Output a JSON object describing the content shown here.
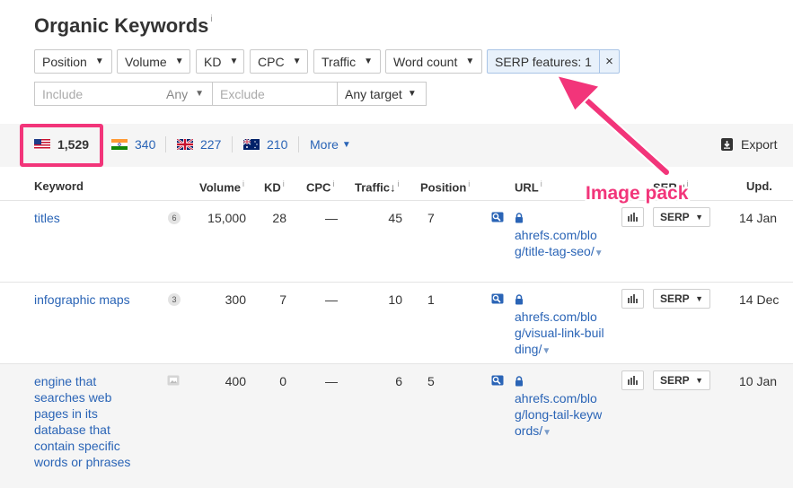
{
  "page": {
    "title": "Organic Keywords",
    "info_mark": "i"
  },
  "filters": {
    "position": "Position",
    "volume": "Volume",
    "kd": "KD",
    "cpc": "CPC",
    "traffic": "Traffic",
    "word_count": "Word count",
    "serp_features": "SERP features: 1",
    "serp_clear": "×",
    "caret": "▼"
  },
  "search": {
    "include_placeholder": "Include",
    "any_label": "Any",
    "exclude_placeholder": "Exclude",
    "any_target": "Any target"
  },
  "countries": [
    {
      "code": "us",
      "count": "1,529"
    },
    {
      "code": "in",
      "count": "340"
    },
    {
      "code": "gb",
      "count": "227"
    },
    {
      "code": "au",
      "count": "210"
    }
  ],
  "more_label": "More",
  "export_label": "Export",
  "table": {
    "headers": {
      "keyword": "Keyword",
      "volume": "Volume",
      "kd": "KD",
      "cpc": "CPC",
      "traffic": "Traffic",
      "traffic_sort": "↓",
      "position": "Position",
      "url": "URL",
      "serp": "SERP",
      "upd": "Upd."
    },
    "rows": [
      {
        "keyword": "titles",
        "badge": "6",
        "volume": "15,000",
        "kd": "28",
        "cpc": "—",
        "traffic": "45",
        "position": "7",
        "url": "ahrefs.com/blog/title-tag-seo/",
        "serp_label": "SERP",
        "updated": "14 Jan"
      },
      {
        "keyword": "infographic maps",
        "badge": "3",
        "volume": "300",
        "kd": "7",
        "cpc": "—",
        "traffic": "10",
        "position": "1",
        "url": "ahrefs.com/blog/visual-link-building/",
        "serp_label": "SERP",
        "updated": "14 Dec"
      },
      {
        "keyword": "engine that searches web pages in its database that contain specific words or phrases",
        "badge": "",
        "volume": "400",
        "kd": "0",
        "cpc": "—",
        "traffic": "6",
        "position": "5",
        "url": "ahrefs.com/blog/long-tail-keywords/",
        "serp_label": "SERP",
        "updated": "10 Jan"
      }
    ]
  },
  "annotation": {
    "text": "Image pack",
    "color": "#f2357a"
  },
  "colors": {
    "link": "#2a64b6",
    "highlight": "#f2357a",
    "filter_active_bg": "#e8f1fb"
  }
}
